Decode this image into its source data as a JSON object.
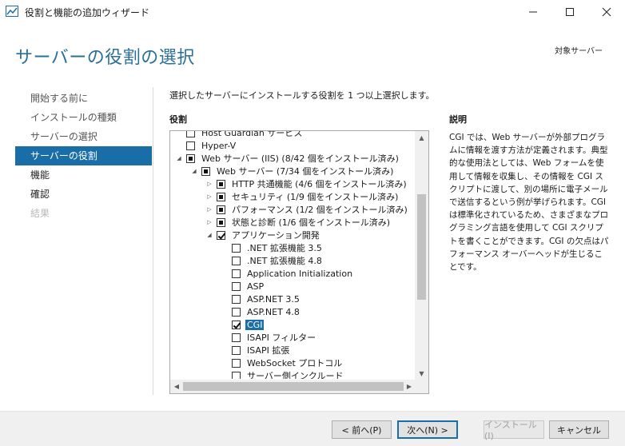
{
  "window": {
    "title": "役割と機能の追加ウィザード"
  },
  "header": {
    "page_title": "サーバーの役割の選択",
    "target_server_label": "対象サーバー"
  },
  "nav": {
    "items": [
      {
        "label": "開始する前に",
        "state": "normal"
      },
      {
        "label": "インストールの種類",
        "state": "normal"
      },
      {
        "label": "サーバーの選択",
        "state": "normal"
      },
      {
        "label": "サーバーの役割",
        "state": "active"
      },
      {
        "label": "機能",
        "state": "normal"
      },
      {
        "label": "確認",
        "state": "normal"
      },
      {
        "label": "結果",
        "state": "disabled"
      }
    ]
  },
  "main": {
    "instruction": "選択したサーバーにインストールする役割を 1 つ以上選択します。",
    "roles_heading": "役割",
    "description_heading": "説明",
    "description_text": "CGI では、Web サーバーが外部プログラムに情報を渡す方法が定義されます。典型的な使用法としては、Web フォームを使用して情報を収集し、その情報を CGI スクリプトに渡して、別の場所に電子メールで送信するという例が挙げられます。CGI は標準化されているため、さまざまなプログラミング言語を使用して CGI スクリプトを書くことができます。CGI の欠点はパフォーマンス オーバーヘッドが生じることです。"
  },
  "tree": {
    "items": [
      {
        "label": "Host Guardian サービス",
        "level": 0,
        "expander": "",
        "check": "unchecked"
      },
      {
        "label": "Hyper-V",
        "level": 0,
        "expander": "",
        "check": "unchecked"
      },
      {
        "label": "Web サーバー (IIS) (8/42 個をインストール済み)",
        "level": 0,
        "expander": "expanded",
        "check": "partial"
      },
      {
        "label": "Web サーバー (7/34 個をインストール済み)",
        "level": 1,
        "expander": "expanded",
        "check": "partial"
      },
      {
        "label": "HTTP 共通機能 (4/6 個をインストール済み)",
        "level": 2,
        "expander": "collapsed",
        "check": "partial"
      },
      {
        "label": "セキュリティ (1/9 個をインストール済み)",
        "level": 2,
        "expander": "collapsed",
        "check": "partial"
      },
      {
        "label": "パフォーマンス (1/2 個をインストール済み)",
        "level": 2,
        "expander": "collapsed",
        "check": "partial"
      },
      {
        "label": "状態と診断 (1/6 個をインストール済み)",
        "level": 2,
        "expander": "collapsed",
        "check": "partial"
      },
      {
        "label": "アプリケーション開発",
        "level": 2,
        "expander": "expanded",
        "check": "checked"
      },
      {
        "label": ".NET 拡張機能 3.5",
        "level": 3,
        "expander": "",
        "check": "unchecked"
      },
      {
        "label": ".NET 拡張機能 4.8",
        "level": 3,
        "expander": "",
        "check": "unchecked"
      },
      {
        "label": "Application Initialization",
        "level": 3,
        "expander": "",
        "check": "unchecked"
      },
      {
        "label": "ASP",
        "level": 3,
        "expander": "",
        "check": "unchecked"
      },
      {
        "label": "ASP.NET 3.5",
        "level": 3,
        "expander": "",
        "check": "unchecked"
      },
      {
        "label": "ASP.NET 4.8",
        "level": 3,
        "expander": "",
        "check": "unchecked"
      },
      {
        "label": "CGI",
        "level": 3,
        "expander": "",
        "check": "checked",
        "selected": true
      },
      {
        "label": "ISAPI フィルター",
        "level": 3,
        "expander": "",
        "check": "unchecked"
      },
      {
        "label": "ISAPI 拡張",
        "level": 3,
        "expander": "",
        "check": "unchecked"
      },
      {
        "label": "WebSocket プロトコル",
        "level": 3,
        "expander": "",
        "check": "unchecked"
      },
      {
        "label": "サーバー側インクルード",
        "level": 3,
        "expander": "",
        "check": "unchecked"
      }
    ]
  },
  "footer": {
    "prev_label": "< 前へ(P)",
    "next_label": "次へ(N) >",
    "install_label": "インストール(I)",
    "cancel_label": "キャンセル"
  },
  "colors": {
    "accent": "#1a6ea8",
    "title_blue": "#2a6f97"
  },
  "icons": {
    "app": "server-manager-icon",
    "expanded": "triangle-down-icon",
    "collapsed": "triangle-right-icon"
  }
}
